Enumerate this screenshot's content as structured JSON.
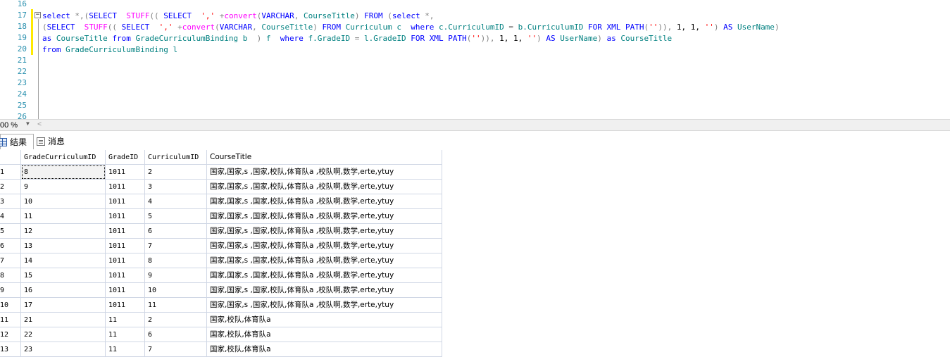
{
  "editor": {
    "line_numbers": [
      "16",
      "17",
      "18",
      "19",
      "20",
      "21",
      "22",
      "23",
      "24",
      "25",
      "26"
    ],
    "fold_symbol": "−",
    "code_lines": [
      [
        {
          "t": "select",
          "c": "kw"
        },
        {
          "t": " ",
          "c": "tx"
        },
        {
          "t": "*,(",
          "c": "op"
        },
        {
          "t": "SELECT",
          "c": "kw"
        },
        {
          "t": "  ",
          "c": "tx"
        },
        {
          "t": "STUFF",
          "c": "fn"
        },
        {
          "t": "((",
          "c": "op"
        },
        {
          "t": " ",
          "c": "tx"
        },
        {
          "t": "SELECT",
          "c": "kw"
        },
        {
          "t": "  ",
          "c": "tx"
        },
        {
          "t": "','",
          "c": "str"
        },
        {
          "t": " +",
          "c": "op"
        },
        {
          "t": "convert",
          "c": "fn"
        },
        {
          "t": "(",
          "c": "op"
        },
        {
          "t": "VARCHAR",
          "c": "kw"
        },
        {
          "t": ",",
          "c": "op"
        },
        {
          "t": " CourseTitle",
          "c": "id"
        },
        {
          "t": ")",
          "c": "op"
        },
        {
          "t": " ",
          "c": "tx"
        },
        {
          "t": "FROM",
          "c": "kw"
        },
        {
          "t": " (",
          "c": "op"
        },
        {
          "t": "select",
          "c": "kw"
        },
        {
          "t": " *,",
          "c": "op"
        }
      ],
      [
        {
          "t": "(",
          "c": "op"
        },
        {
          "t": "SELECT",
          "c": "kw"
        },
        {
          "t": "  ",
          "c": "tx"
        },
        {
          "t": "STUFF",
          "c": "fn"
        },
        {
          "t": "((",
          "c": "op"
        },
        {
          "t": " ",
          "c": "tx"
        },
        {
          "t": "SELECT",
          "c": "kw"
        },
        {
          "t": "  ",
          "c": "tx"
        },
        {
          "t": "','",
          "c": "str"
        },
        {
          "t": " +",
          "c": "op"
        },
        {
          "t": "convert",
          "c": "fn"
        },
        {
          "t": "(",
          "c": "op"
        },
        {
          "t": "VARCHAR",
          "c": "kw"
        },
        {
          "t": ",",
          "c": "op"
        },
        {
          "t": " CourseTitle",
          "c": "id"
        },
        {
          "t": ")",
          "c": "op"
        },
        {
          "t": " ",
          "c": "tx"
        },
        {
          "t": "FROM",
          "c": "kw"
        },
        {
          "t": " Curriculum c  ",
          "c": "id"
        },
        {
          "t": "where",
          "c": "kw"
        },
        {
          "t": " c.CurriculumID ",
          "c": "id"
        },
        {
          "t": "=",
          "c": "op"
        },
        {
          "t": " b.CurriculumID ",
          "c": "id"
        },
        {
          "t": "FOR XML PATH",
          "c": "kw"
        },
        {
          "t": "(",
          "c": "op"
        },
        {
          "t": "''",
          "c": "str"
        },
        {
          "t": ")),",
          "c": "op"
        },
        {
          "t": " 1, 1, ",
          "c": "tx"
        },
        {
          "t": "''",
          "c": "str"
        },
        {
          "t": ")",
          "c": "op"
        },
        {
          "t": " ",
          "c": "tx"
        },
        {
          "t": "AS",
          "c": "kw"
        },
        {
          "t": " UserName",
          "c": "id"
        },
        {
          "t": ")",
          "c": "op"
        }
      ],
      [
        {
          "t": "as",
          "c": "kw"
        },
        {
          "t": " CourseTitle ",
          "c": "id"
        },
        {
          "t": "from",
          "c": "kw"
        },
        {
          "t": " GradeCurriculumBinding b  ",
          "c": "id"
        },
        {
          "t": ")",
          "c": "op"
        },
        {
          "t": " f  ",
          "c": "id"
        },
        {
          "t": "where",
          "c": "kw"
        },
        {
          "t": " f.GradeID ",
          "c": "id"
        },
        {
          "t": "=",
          "c": "op"
        },
        {
          "t": " l.GradeID ",
          "c": "id"
        },
        {
          "t": "FOR XML PATH",
          "c": "kw"
        },
        {
          "t": "(",
          "c": "op"
        },
        {
          "t": "''",
          "c": "str"
        },
        {
          "t": ")),",
          "c": "op"
        },
        {
          "t": " 1, 1, ",
          "c": "tx"
        },
        {
          "t": "''",
          "c": "str"
        },
        {
          "t": ")",
          "c": "op"
        },
        {
          "t": " ",
          "c": "tx"
        },
        {
          "t": "AS",
          "c": "kw"
        },
        {
          "t": " UserName",
          "c": "id"
        },
        {
          "t": ")",
          "c": "op"
        },
        {
          "t": " ",
          "c": "tx"
        },
        {
          "t": "as",
          "c": "kw"
        },
        {
          "t": " CourseTitle",
          "c": "id"
        }
      ],
      [
        {
          "t": "from",
          "c": "kw"
        },
        {
          "t": " GradeCurriculumBinding l",
          "c": "id"
        }
      ]
    ]
  },
  "zoom": {
    "value": "00 %",
    "arrow": "▼",
    "scroll_left": "<"
  },
  "tabs": [
    {
      "label": "结果",
      "icon": "grid-icon",
      "active": true
    },
    {
      "label": "消息",
      "icon": "message-icon",
      "active": false
    }
  ],
  "results": {
    "columns": [
      "",
      "GradeCurriculumID",
      "GradeID",
      "CurriculumID",
      "CourseTitle"
    ],
    "rows": [
      [
        "1",
        "8",
        "1011",
        "2",
        "国家,国家,s ,国家,校队,体育队a ,校队啊,数学,erte,ytuy"
      ],
      [
        "2",
        "9",
        "1011",
        "3",
        "国家,国家,s ,国家,校队,体育队a ,校队啊,数学,erte,ytuy"
      ],
      [
        "3",
        "10",
        "1011",
        "4",
        "国家,国家,s ,国家,校队,体育队a ,校队啊,数学,erte,ytuy"
      ],
      [
        "4",
        "11",
        "1011",
        "5",
        "国家,国家,s ,国家,校队,体育队a ,校队啊,数学,erte,ytuy"
      ],
      [
        "5",
        "12",
        "1011",
        "6",
        "国家,国家,s ,国家,校队,体育队a ,校队啊,数学,erte,ytuy"
      ],
      [
        "6",
        "13",
        "1011",
        "7",
        "国家,国家,s ,国家,校队,体育队a ,校队啊,数学,erte,ytuy"
      ],
      [
        "7",
        "14",
        "1011",
        "8",
        "国家,国家,s ,国家,校队,体育队a ,校队啊,数学,erte,ytuy"
      ],
      [
        "8",
        "15",
        "1011",
        "9",
        "国家,国家,s ,国家,校队,体育队a ,校队啊,数学,erte,ytuy"
      ],
      [
        "9",
        "16",
        "1011",
        "10",
        "国家,国家,s ,国家,校队,体育队a ,校队啊,数学,erte,ytuy"
      ],
      [
        "10",
        "17",
        "1011",
        "11",
        "国家,国家,s ,国家,校队,体育队a ,校队啊,数学,erte,ytuy"
      ],
      [
        "11",
        "21",
        "11",
        "2",
        "国家,校队,体育队a"
      ],
      [
        "12",
        "22",
        "11",
        "6",
        "国家,校队,体育队a"
      ],
      [
        "13",
        "23",
        "11",
        "7",
        "国家,校队,体育队a"
      ]
    ]
  }
}
